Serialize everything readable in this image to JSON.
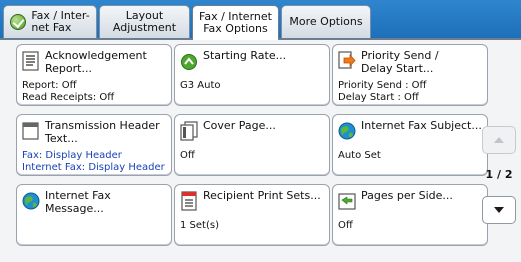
{
  "tabs": [
    {
      "label": "Fax / Inter-\nnet Fax",
      "icon": "check-circle-icon",
      "active": false
    },
    {
      "label": "Layout\nAdjustment",
      "active": false
    },
    {
      "label": "Fax / Internet\nFax Options",
      "active": true
    },
    {
      "label": "More Options",
      "active": false
    }
  ],
  "cards": [
    {
      "title": "Acknowledgement\nReport...",
      "icon": "report-document-icon",
      "values": "Report: Off\nRead Receipts: Off"
    },
    {
      "title": "Starting Rate...",
      "icon": "green-arrow-circle-icon",
      "values": "G3 Auto"
    },
    {
      "title": "Priority Send /\nDelay Start...",
      "icon": "priority-send-arrow-icon",
      "values": "Priority Send : Off\nDelay Start : Off"
    },
    {
      "title": "Transmission Header\nText...",
      "icon": "header-document-icon",
      "values": "Fax: Display Header\nInternet Fax: Display Header"
    },
    {
      "title": "Cover Page...",
      "icon": "cover-page-icon",
      "values": "Off"
    },
    {
      "title": "Internet Fax Subject...",
      "icon": "globe-icon",
      "values": "Auto Set"
    },
    {
      "title": "Internet Fax\nMessage...",
      "icon": "globe-icon",
      "values": ""
    },
    {
      "title": "Recipient Print Sets...",
      "icon": "print-sets-icon",
      "values": "1 Set(s)"
    },
    {
      "title": "Pages per Side...",
      "icon": "pages-per-side-icon",
      "values": "Off"
    }
  ],
  "pager": {
    "text": "1 / 2",
    "up_icon": "triangle-up-icon",
    "down_icon": "triangle-down-icon"
  }
}
